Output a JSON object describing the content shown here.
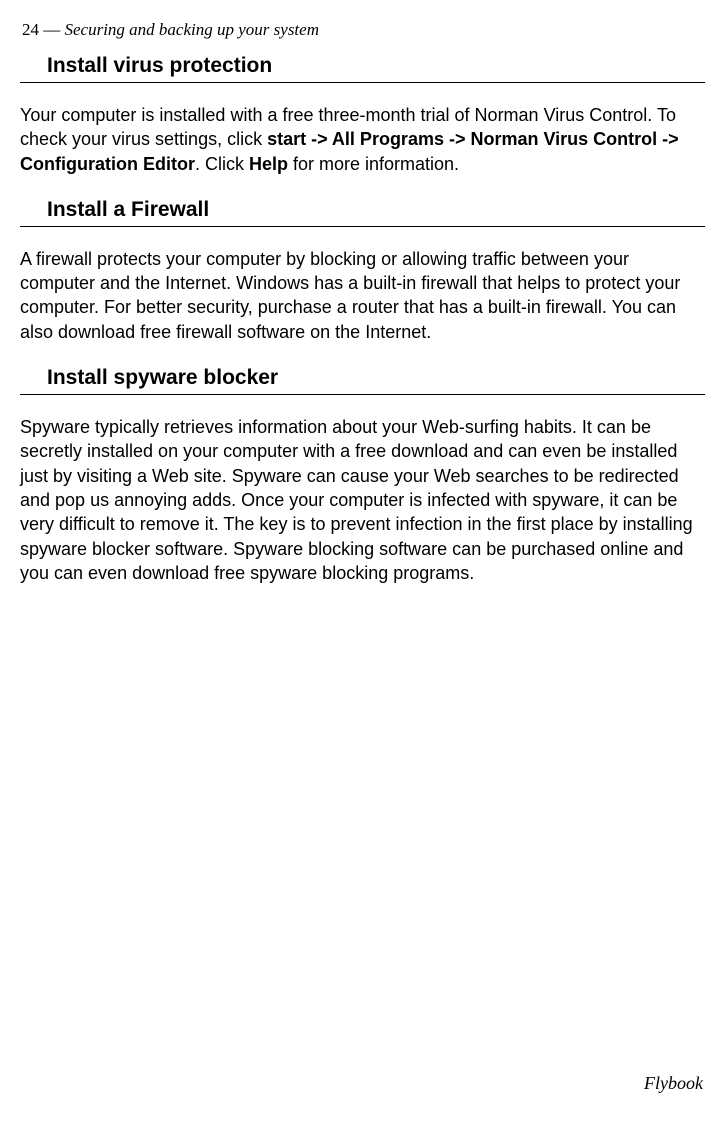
{
  "header": {
    "page_number": "24",
    "separator": "  —  ",
    "chapter_title": "Securing and backing up your system"
  },
  "sections": [
    {
      "heading": "Install virus protection",
      "body_parts": {
        "p1_a": "Your computer is installed with a free three-month trial of Norman Virus Control. To check your virus settings, click ",
        "p1_b": "start -> All Programs -> Norman Virus Control -> Configuration Editor",
        "p1_c": ". Click ",
        "p1_d": "Help",
        "p1_e": " for more information."
      }
    },
    {
      "heading": "Install a Firewall",
      "body": "A firewall protects your computer by blocking or allowing traffic between your computer and the Internet. Windows has a built-in firewall that helps to protect your computer. For better security, purchase a router that has a built-in firewall. You can also download free firewall software on the Internet."
    },
    {
      "heading": "Install spyware blocker",
      "body": "Spyware typically retrieves information about your Web-surfing habits. It can be secretly installed on your computer with a free download and can even be installed just by visiting a Web site. Spyware can cause your Web searches to be redirected and pop us annoying adds. Once your computer is infected with spyware, it can be very difficult to remove it. The key is to prevent infection in the first place by installing spyware blocker software. Spyware blocking software can be purchased online and you can even download free spyware blocking programs."
    }
  ],
  "footer": {
    "brand": "Flybook"
  }
}
